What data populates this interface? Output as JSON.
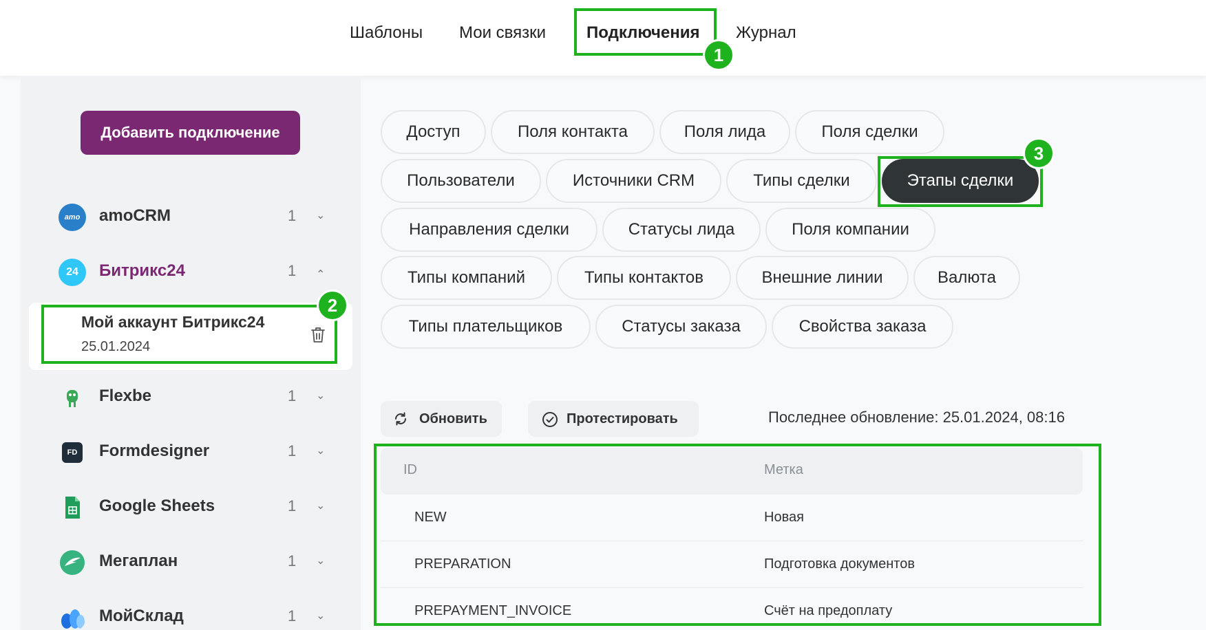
{
  "tabs": [
    {
      "label": "Шаблоны"
    },
    {
      "label": "Мои связки"
    },
    {
      "label": "Подключения",
      "active": true
    },
    {
      "label": "Журнал"
    }
  ],
  "badges": [
    "1",
    "2",
    "3"
  ],
  "sidebar": {
    "add_button": "Добавить подключение",
    "services": [
      {
        "name": "amoCRM",
        "count": "1",
        "icon": "amocrm-logo",
        "logo_text": "amo",
        "color": "#2a7fc9"
      },
      {
        "name": "Битрикс24",
        "count": "1",
        "icon": "bitrix24-logo",
        "logo_text": "24",
        "color": "#2fc7f7",
        "expanded": true
      },
      {
        "name": "Flexbe",
        "count": "1",
        "icon": "flexbe-logo",
        "color": "#3aa856"
      },
      {
        "name": "Formdesigner",
        "count": "1",
        "icon": "formdesigner-logo",
        "logo_text": "FD",
        "color": "#1f2d3a"
      },
      {
        "name": "Google Sheets",
        "count": "1",
        "icon": "google-sheets-logo",
        "color": "#1e9e5a"
      },
      {
        "name": "Мегаплан",
        "count": "1",
        "icon": "megaplan-logo",
        "color": "#36b37e"
      },
      {
        "name": "МойСклад",
        "count": "1",
        "icon": "moysklad-logo",
        "color": "#1f6fe0"
      }
    ],
    "account": {
      "name": "Мой аккаунт Битрикс24",
      "date": "25.01.2024"
    }
  },
  "pills": [
    "Доступ",
    "Поля контакта",
    "Поля лида",
    "Поля сделки",
    "Пользователи",
    "Источники CRM",
    "Типы сделки",
    "Этапы сделки",
    "Направления сделки",
    "Статусы лида",
    "Поля компании",
    "Типы компаний",
    "Типы контактов",
    "Внешние линии",
    "Валюта",
    "Типы плательщиков",
    "Статусы заказа",
    "Свойства заказа"
  ],
  "active_pill": "Этапы сделки",
  "toolbar": {
    "refresh_label": "Обновить",
    "test_label": "Протестировать",
    "last_update": "Последнее обновление: 25.01.2024, 08:16"
  },
  "table": {
    "headers": [
      "ID",
      "Метка"
    ],
    "rows": [
      [
        "NEW",
        "Новая"
      ],
      [
        "PREPARATION",
        "Подготовка документов"
      ],
      [
        "PREPAYMENT_INVOICE",
        "Счёт на предоплату"
      ]
    ]
  },
  "colors": {
    "accent": "#7b2873",
    "highlight": "#1fb21f",
    "active_pill": "#2f3436"
  }
}
